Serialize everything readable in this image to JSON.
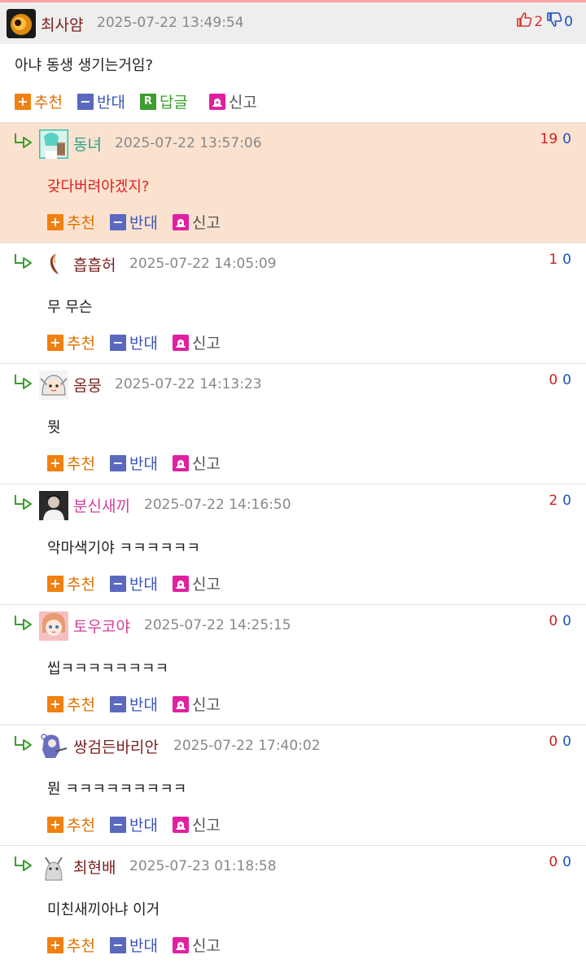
{
  "colors": {
    "accent_line": "#f6a2a6",
    "highlight_bg": "#fbe2cf",
    "upvote": "#e07000",
    "downvote": "#3a56b8",
    "reply": "#3b9e2e",
    "report": "#e020a0"
  },
  "post": {
    "author": "최사얌",
    "timestamp": "2025-07-22 13:49:54",
    "likes": "2",
    "dislikes": "0",
    "body": "아냐 동생 생기는거임?",
    "actions": {
      "up": "추천",
      "down": "반대",
      "reply": "답글",
      "report": "신고"
    },
    "icons": {
      "like": "thumbs-up-icon",
      "dislike": "thumbs-down-icon"
    }
  },
  "comments": [
    {
      "author": "동녀",
      "author_color": "#2aa08a",
      "timestamp": "2025-07-22 13:57:06",
      "up": "19",
      "down": "0",
      "body": "갖다버려야겠지?",
      "body_color": "#e02020",
      "highlight": true
    },
    {
      "author": "흡흡허",
      "author_color": "#7a1f1f",
      "timestamp": "2025-07-22 14:05:09",
      "up": "1",
      "down": "0",
      "body": "무 무슨",
      "body_color": "#222222",
      "highlight": false
    },
    {
      "author": "옴뭉",
      "author_color": "#7a1f1f",
      "timestamp": "2025-07-22 14:13:23",
      "up": "0",
      "down": "0",
      "body": "뭣",
      "body_color": "#222222",
      "highlight": false
    },
    {
      "author": "분신새끼",
      "author_color": "#d0409a",
      "timestamp": "2025-07-22 14:16:50",
      "up": "2",
      "down": "0",
      "body": "악마색기야 ㅋㅋㅋㅋㅋㅋ",
      "body_color": "#222222",
      "highlight": false
    },
    {
      "author": "토우코야",
      "author_color": "#d0409a",
      "timestamp": "2025-07-22 14:25:15",
      "up": "0",
      "down": "0",
      "body": "씹ㅋㅋㅋㅋㅋㅋㅋㅋ",
      "body_color": "#222222",
      "highlight": false
    },
    {
      "author": "쌍검든바리안",
      "author_color": "#7a1f1f",
      "timestamp": "2025-07-22 17:40:02",
      "up": "0",
      "down": "0",
      "body": "뭔 ㅋㅋㅋㅋㅋㅋㅋㅋㅋ",
      "body_color": "#222222",
      "highlight": false
    },
    {
      "author": "최현배",
      "author_color": "#7a1f1f",
      "timestamp": "2025-07-23 01:18:58",
      "up": "0",
      "down": "0",
      "body": "미친새끼아냐 이거",
      "body_color": "#222222",
      "highlight": false
    }
  ],
  "comment_actions": {
    "up": "추천",
    "down": "반대",
    "report": "신고"
  },
  "icon_names": {
    "reply_arrow": "reply-arrow-icon",
    "up_badge": "plus-icon",
    "down_badge": "minus-icon",
    "reply_badge": "r-icon",
    "report_badge": "siren-icon"
  }
}
